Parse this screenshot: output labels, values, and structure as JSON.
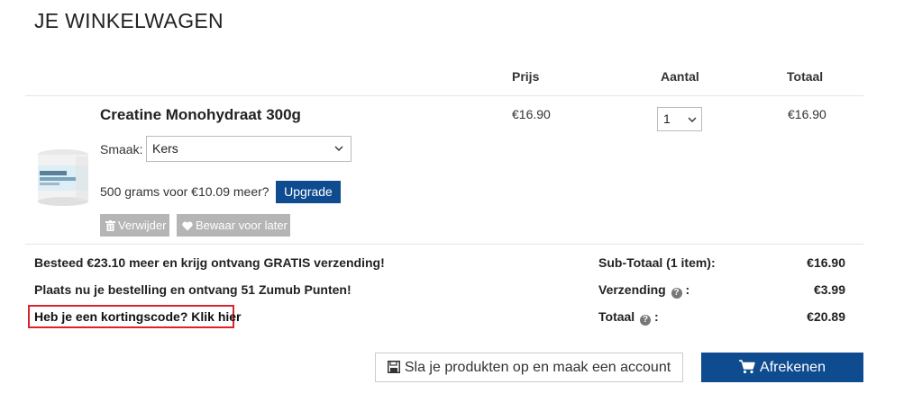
{
  "page": {
    "title": "JE WINKELWAGEN"
  },
  "table": {
    "headers": {
      "price": "Prijs",
      "qty": "Aantal",
      "total": "Totaal"
    }
  },
  "item": {
    "name": "Creatine Monohydraat 300g",
    "flavor_label": "Smaak:",
    "flavor_value": "Kers",
    "upgrade_text": "500 grams voor €10.09 meer?",
    "upgrade_button": "Upgrade",
    "remove_button": "Verwijder",
    "save_later_button": "Bewaar voor later",
    "price": "€16.90",
    "quantity": "1",
    "total": "€16.90"
  },
  "info": {
    "free_shipping": "Besteed €23.10 meer en krijg ontvang GRATIS verzending!",
    "points": "Plaats nu je bestelling en ontvang 51 Zumub Punten!",
    "coupon": "Heb je een kortingscode? Klik hier"
  },
  "summary": {
    "subtotal_label": "Sub-Totaal (1 item):",
    "subtotal_value": "€16.90",
    "shipping_label": "Verzending",
    "shipping_value": "€3.99",
    "total_label": "Totaal",
    "total_value": "€20.89",
    "colon": ":"
  },
  "actions": {
    "save_account": "Sla je produkten op en maak een account",
    "checkout": "Afrekenen"
  },
  "colors": {
    "primary": "#0e4b8f",
    "highlight": "#d9232d",
    "grey_button": "#b5b5b5"
  }
}
